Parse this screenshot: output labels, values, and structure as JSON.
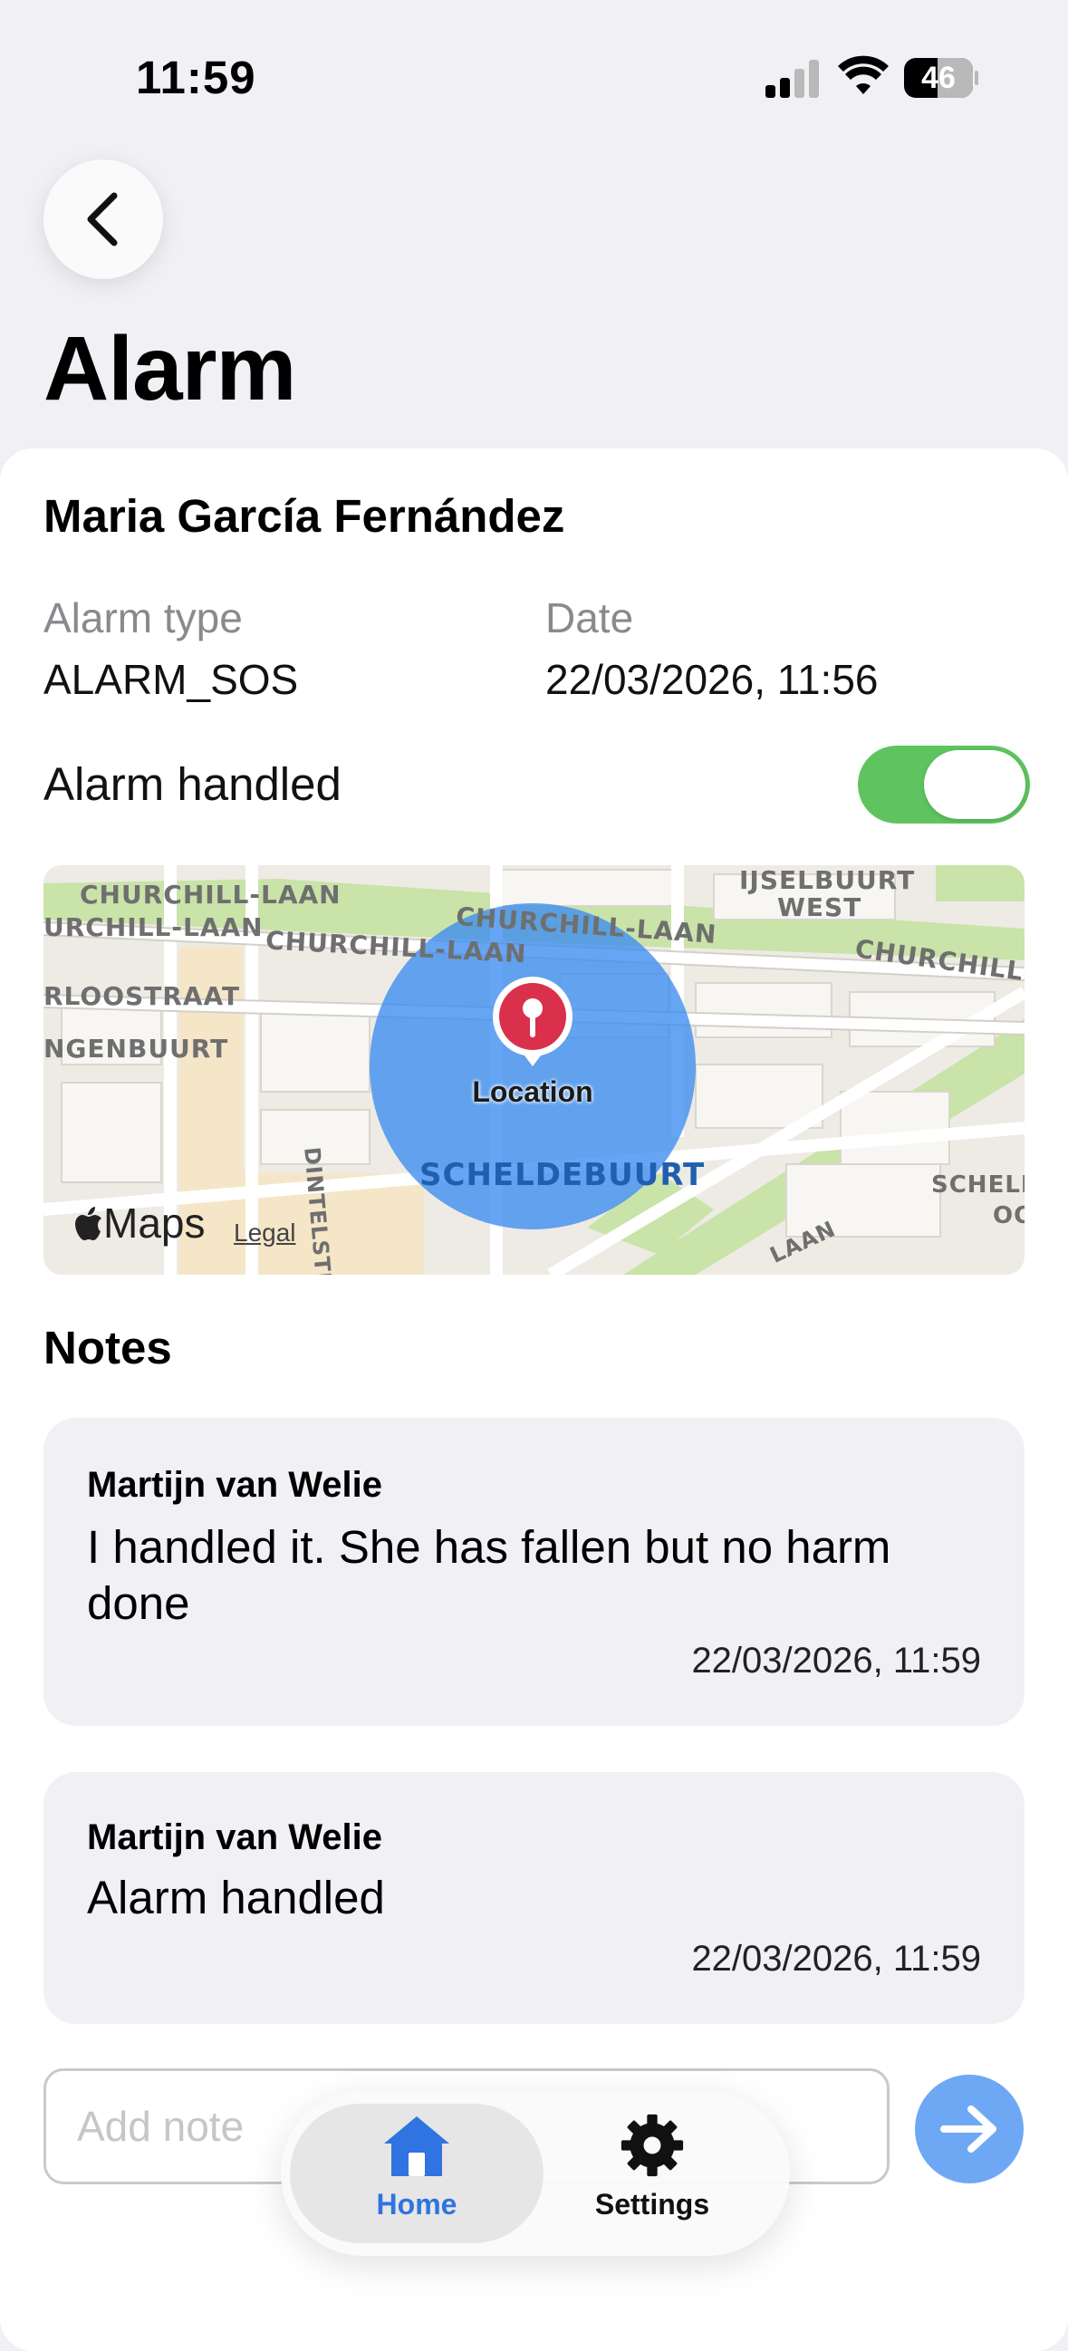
{
  "status_bar": {
    "time": "11:59",
    "battery": "46"
  },
  "header": {
    "title": "Alarm"
  },
  "alarm": {
    "person": "Maria García Fernández",
    "type_label": "Alarm type",
    "type_value": "ALARM_SOS",
    "date_label": "Date",
    "date_value": "22/03/2026, 11:56",
    "handled_label": "Alarm handled",
    "handled": true
  },
  "map": {
    "streets": [
      "CHURCHILL-LAAN",
      "URCHILL-LAAN",
      "CHURCHILL-LAAN",
      "CHURCHILL-LAAN",
      "CHURCHILL-LA",
      "RLOOSTRAAT",
      "NGENBUURT",
      "DINTELSTRAAT",
      "IJSELBUURT",
      "WEST",
      "SCHELD",
      "OO",
      "LAAN"
    ],
    "district": "SCHELDEBUURT",
    "pin_label": "Location",
    "maps_brand": "Maps",
    "legal": "Legal",
    "accent_color": "#3b8cf0",
    "pin_color": "#d9304c"
  },
  "notes": {
    "title": "Notes",
    "items": [
      {
        "author": "Martijn van Welie",
        "text": "I handled it. She has fallen but no harm done",
        "timestamp": "22/03/2026, 11:59"
      },
      {
        "author": "Martijn van Welie",
        "text": "Alarm handled",
        "timestamp": "22/03/2026, 11:59"
      }
    ],
    "input_placeholder": "Add note"
  },
  "tabbar": {
    "items": [
      {
        "label": "Home",
        "icon": "house-icon",
        "active": true,
        "color": "#2f74e0"
      },
      {
        "label": "Settings",
        "icon": "gear-icon",
        "active": false,
        "color": "#111111"
      }
    ]
  }
}
